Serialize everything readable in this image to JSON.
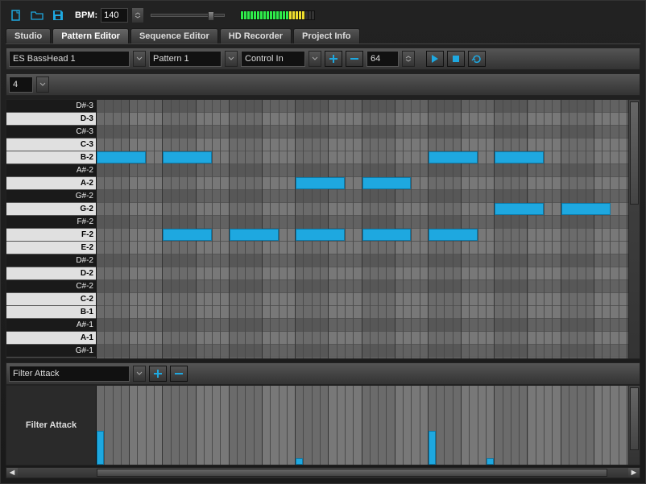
{
  "toolbar": {
    "bpm_label": "BPM:",
    "bpm_value": "140",
    "icons": {
      "new": "new-file-icon",
      "open": "open-folder-icon",
      "save": "save-icon"
    }
  },
  "vu_meter": {
    "segments": 23,
    "green_until": 15,
    "yellow_until": 20
  },
  "tabs": [
    {
      "label": "Studio",
      "active": false
    },
    {
      "label": "Pattern Editor",
      "active": true
    },
    {
      "label": "Sequence Editor",
      "active": false
    },
    {
      "label": "HD Recorder",
      "active": false
    },
    {
      "label": "Project Info",
      "active": false
    }
  ],
  "subbar": {
    "instrument": "ES BassHead 1",
    "pattern": "Pattern 1",
    "control": "Control In",
    "steps_value": "64",
    "plus": "+",
    "minus": "−"
  },
  "rowbar": {
    "zoom": "4"
  },
  "piano": {
    "rows": [
      {
        "label": "D#-3",
        "black": true
      },
      {
        "label": "D-3",
        "black": false
      },
      {
        "label": "C#-3",
        "black": true
      },
      {
        "label": "C-3",
        "black": false
      },
      {
        "label": "B-2",
        "black": false
      },
      {
        "label": "A#-2",
        "black": true
      },
      {
        "label": "A-2",
        "black": false
      },
      {
        "label": "G#-2",
        "black": true
      },
      {
        "label": "G-2",
        "black": false
      },
      {
        "label": "F#-2",
        "black": true
      },
      {
        "label": "F-2",
        "black": false
      },
      {
        "label": "E-2",
        "black": false
      },
      {
        "label": "D#-2",
        "black": true
      },
      {
        "label": "D-2",
        "black": false
      },
      {
        "label": "C#-2",
        "black": true
      },
      {
        "label": "C-2",
        "black": false
      },
      {
        "label": "B-1",
        "black": false
      },
      {
        "label": "A#-1",
        "black": true
      },
      {
        "label": "A-1",
        "black": false
      },
      {
        "label": "G#-1",
        "black": true
      }
    ],
    "total_steps": 64,
    "notes": [
      {
        "row": 4,
        "step": 0,
        "len": 6
      },
      {
        "row": 4,
        "step": 8,
        "len": 6
      },
      {
        "row": 4,
        "step": 40,
        "len": 6
      },
      {
        "row": 4,
        "step": 48,
        "len": 6
      },
      {
        "row": 6,
        "step": 24,
        "len": 6
      },
      {
        "row": 6,
        "step": 32,
        "len": 6
      },
      {
        "row": 8,
        "step": 48,
        "len": 6
      },
      {
        "row": 8,
        "step": 56,
        "len": 6
      },
      {
        "row": 10,
        "step": 8,
        "len": 6
      },
      {
        "row": 10,
        "step": 16,
        "len": 6
      },
      {
        "row": 10,
        "step": 24,
        "len": 6
      },
      {
        "row": 10,
        "step": 32,
        "len": 6
      },
      {
        "row": 10,
        "step": 40,
        "len": 6
      }
    ]
  },
  "automation": {
    "param": "Filter Attack",
    "label": "Filter Attack",
    "bars": [
      {
        "step": 0,
        "h": 42
      },
      {
        "step": 24,
        "h": 8
      },
      {
        "step": 40,
        "h": 42
      },
      {
        "step": 47,
        "h": 8
      }
    ]
  },
  "colors": {
    "accent": "#1ea8e0"
  }
}
